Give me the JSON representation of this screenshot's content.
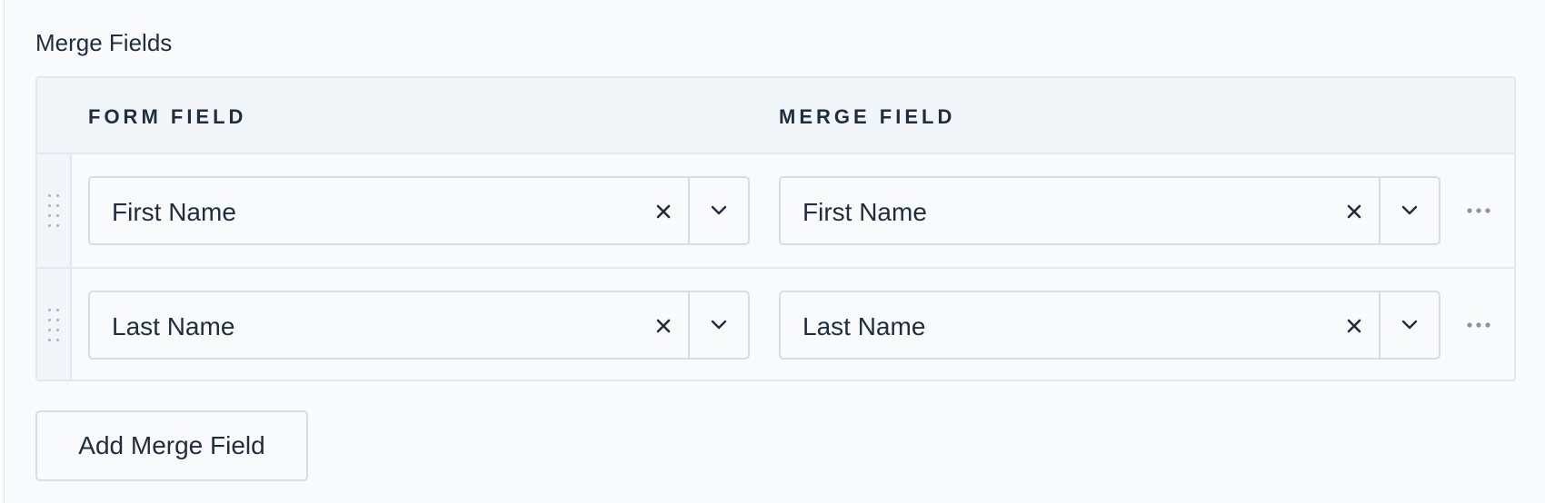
{
  "section": {
    "title": "Merge Fields"
  },
  "table": {
    "headers": [
      "FORM FIELD",
      "MERGE FIELD"
    ],
    "rows": [
      {
        "form_field": "First Name",
        "merge_field": "First Name"
      },
      {
        "form_field": "Last Name",
        "merge_field": "Last Name"
      }
    ]
  },
  "actions": {
    "add_label": "Add Merge Field"
  },
  "icons": {
    "clear": "close-icon",
    "toggle": "chevron-down-icon",
    "more": "more-horizontal-icon",
    "drag": "drag-handle-icon"
  },
  "colors": {
    "text": "#1f2d3d",
    "border": "#d6dde6",
    "header_bg": "#f3f6f9",
    "panel_bg": "#f9fafc"
  }
}
